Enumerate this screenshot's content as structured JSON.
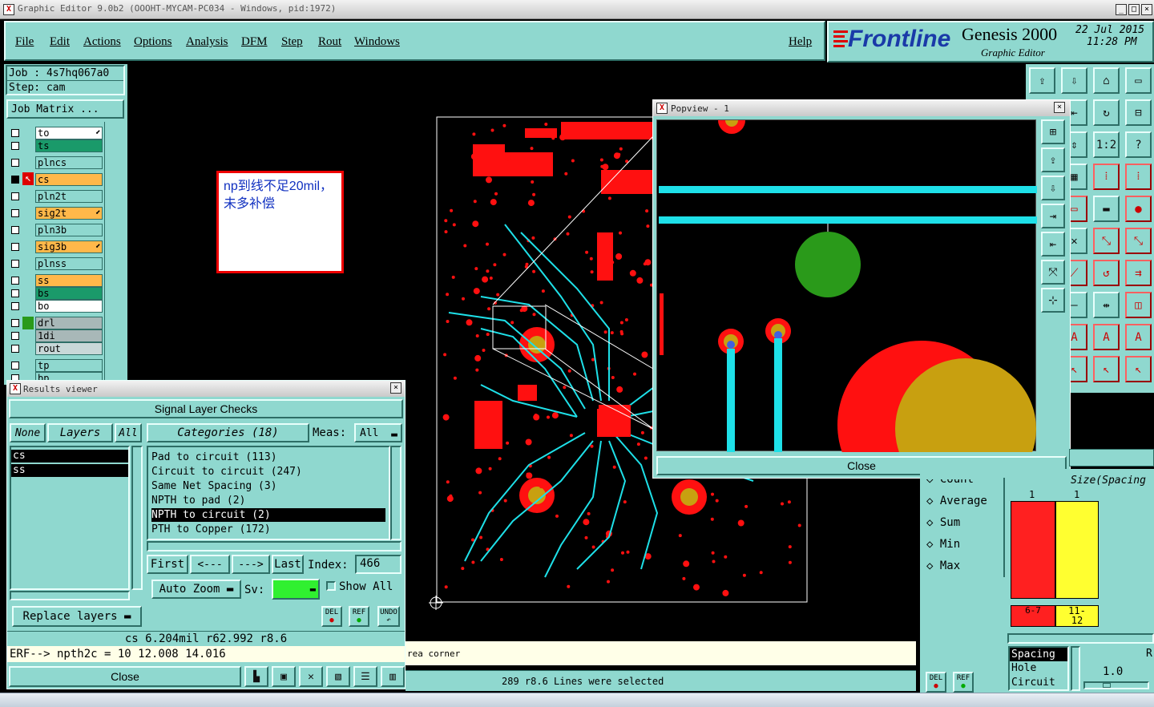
{
  "window": {
    "title": "Graphic Editor 9.0b2 (OOOHT-MYCAM-PC034 - Windows, pid:1972)"
  },
  "menu": [
    "File",
    "Edit",
    "Actions",
    "Options",
    "Analysis",
    "DFM",
    "Step",
    "Rout",
    "Windows"
  ],
  "help": "Help",
  "brand": {
    "logo": "Frontline",
    "product": "Genesis 2000",
    "subtitle": "Graphic Editor",
    "date": "22 Jul 2015",
    "time": "11:28 PM"
  },
  "job": {
    "job_label": "Job : 4s7hq067a0",
    "step_label": "Step: cam",
    "matrix_button": "Job Matrix ..."
  },
  "layers": [
    {
      "name": "to",
      "color": "#ffffff",
      "arrow": true
    },
    {
      "name": "ts",
      "color": "#1a9a6a"
    },
    {
      "name": "plncs",
      "color": "#8fd8cf"
    },
    {
      "name": "cs",
      "color": "#ffb84a",
      "active": true
    },
    {
      "name": "pln2t",
      "color": "#8fd8cf"
    },
    {
      "name": "sig2t",
      "color": "#ffb84a",
      "arrow": true
    },
    {
      "name": "pln3b",
      "color": "#8fd8cf"
    },
    {
      "name": "sig3b",
      "color": "#ffb84a",
      "arrow": true
    },
    {
      "name": "plnss",
      "color": "#8fd8cf"
    },
    {
      "name": "ss",
      "color": "#ffb84a"
    },
    {
      "name": "bs",
      "color": "#1a9a6a"
    },
    {
      "name": "bo",
      "color": "#ffffff"
    },
    {
      "name": "drl",
      "color": "#a8b8b8"
    },
    {
      "name": "1di",
      "color": "#a8b8b8"
    },
    {
      "name": "rout",
      "color": "#c8d8d8"
    },
    {
      "name": "tp",
      "color": "#8fd8cf"
    },
    {
      "name": "bp",
      "color": "#8fd8cf"
    }
  ],
  "note": {
    "text": "np到线不足20mil，未多补偿"
  },
  "popview": {
    "title": "Popview - 1",
    "close": "Close"
  },
  "results": {
    "title": "Results viewer",
    "header": "Signal Layer Checks",
    "none": "None",
    "layers_btn": "Layers",
    "all": "All",
    "layer_items": [
      "cs",
      "ss"
    ],
    "categories_btn": "Categories (18)",
    "meas_label": "Meas:",
    "meas_value": "All",
    "categories": [
      "Pad to circuit (113)",
      "Circuit to circuit (247)",
      "Same Net Spacing (3)",
      "NPTH to pad (2)",
      "NPTH to circuit (2)",
      "PTH to Copper (172)"
    ],
    "selected_index": 4,
    "first": "First",
    "prev": "<---",
    "next": "--->",
    "last": "Last",
    "index_label": "Index:",
    "index_value": "466",
    "auto_zoom": "Auto Zoom",
    "sv": "Sv:",
    "show_all": "Show All",
    "replace_layers": "Replace layers",
    "del": "DEL",
    "ref": "REF",
    "undo": "UNDO",
    "info": "cs 6.204mil   r62.992   r8.6",
    "erf": "ERF--> npth2c = 10 12.008 14.016",
    "close": "Close"
  },
  "status": {
    "corner": "rea corner",
    "selected": "289 r8.6 Lines were selected"
  },
  "histogram": {
    "options": [
      "Count",
      "Average",
      "Sum",
      "Min",
      "Max"
    ],
    "size_label": "Size(Spacing",
    "bars": [
      {
        "count": "1",
        "range": "6-7",
        "color": "#ff2020"
      },
      {
        "count": "1",
        "range": "11-12",
        "color": "#ffff30"
      }
    ],
    "list": [
      "Spacing",
      "Hole",
      "Circuit"
    ],
    "value": "1.0",
    "r_label": "R"
  },
  "colors": {
    "teal": "#8fd8cf",
    "cyan_trace": "#1ee0e8",
    "red_pad": "#ff1010",
    "gold": "#c8a010",
    "green_pad": "#2a9a1a"
  }
}
